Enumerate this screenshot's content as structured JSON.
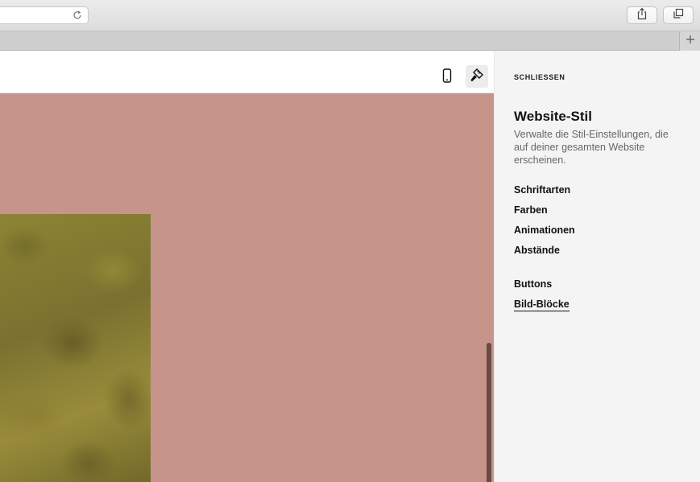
{
  "browser": {
    "icons": {
      "reload": "reload-icon",
      "share": "share-icon",
      "tabs": "tabs-overview-icon",
      "new_tab": "plus-icon"
    }
  },
  "editor": {
    "icons": {
      "mobile_view": "mobile-phone-icon",
      "style": "paintbrush-icon"
    },
    "colors": {
      "canvas": "#c6948b",
      "scrollbar": "#6b4a44"
    }
  },
  "panel": {
    "close_label": "SCHLIESSEN",
    "title": "Website-Stil",
    "description": "Verwalte die Stil-Einstellungen, die auf deiner gesamten Website erscheinen.",
    "items": [
      {
        "label": "Schriftarten"
      },
      {
        "label": "Farben"
      },
      {
        "label": "Animationen"
      },
      {
        "label": "Abstände"
      },
      {
        "label": "Buttons"
      },
      {
        "label": "Bild-Blöcke",
        "active": true
      }
    ]
  }
}
